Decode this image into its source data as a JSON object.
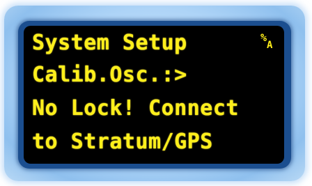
{
  "display": {
    "lines": [
      "System Setup",
      "Calib.Osc.:>",
      "No Lock! Connect",
      "to Stratum/GPS"
    ],
    "indicator": {
      "symbol": "%",
      "sub": "A"
    },
    "colors": {
      "text": "#ffef1a",
      "screen": "#000000",
      "bezel": "#1b4e8f",
      "glow": "#aed4f7"
    }
  }
}
